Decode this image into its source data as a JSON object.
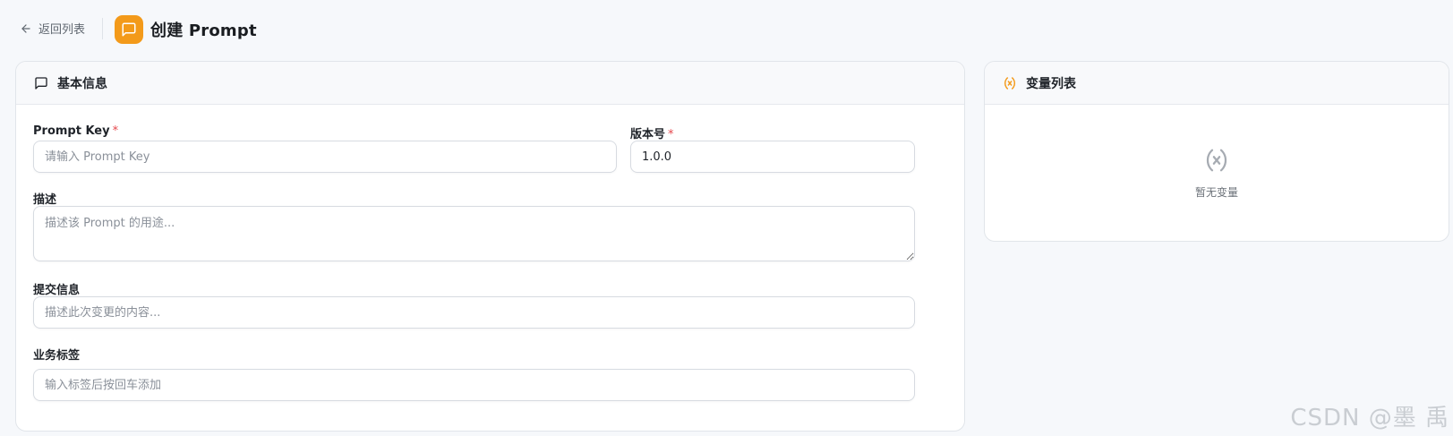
{
  "header": {
    "back_label": "返回列表",
    "title": "创建 Prompt"
  },
  "basic_info": {
    "title": "基本信息",
    "prompt_key": {
      "label": "Prompt Key",
      "required_mark": "*",
      "placeholder": "请输入 Prompt Key",
      "value": ""
    },
    "version": {
      "label": "版本号",
      "required_mark": "*",
      "value": "1.0.0"
    },
    "description": {
      "label": "描述",
      "placeholder": "描述该 Prompt 的用途..."
    },
    "commit_message": {
      "label": "提交信息",
      "placeholder": "描述此次变更的内容..."
    },
    "tags": {
      "label": "业务标签",
      "placeholder": "输入标签后按回车添加"
    }
  },
  "variables": {
    "title": "变量列表",
    "empty_text": "暂无变量"
  },
  "watermark": "CSDN @墨 禹",
  "colors": {
    "accent": "#f39a1a",
    "required": "#e5484d",
    "background": "#f6f8fb"
  },
  "icons": {
    "back": "arrow-left-icon",
    "app": "message-square-icon",
    "basic_info": "message-square-icon",
    "variables": "variable-icon",
    "empty": "variable-icon"
  }
}
